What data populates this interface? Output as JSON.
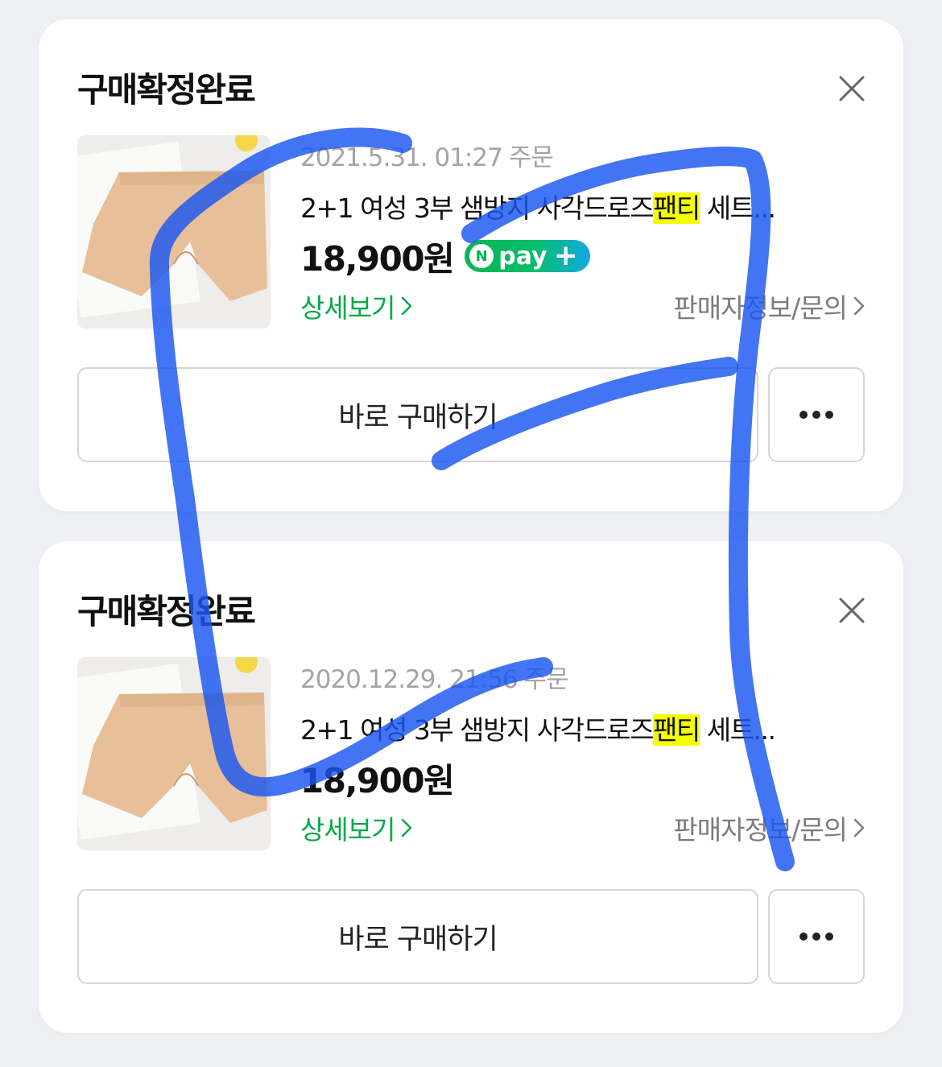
{
  "orders": [
    {
      "status": "구매확정완료",
      "order_date": "2021.5.31. 01:27",
      "order_suffix": "주문",
      "product_name_prefix": "2+1 여성 3부 샘방지 사각드로즈",
      "product_name_highlight": "팬티",
      "product_name_suffix": " 세트...",
      "price": "18,900원",
      "npay": "pay",
      "detail_label": "상세보기",
      "seller_label": "판매자정보/문의",
      "buy_label": "바로 구매하기"
    },
    {
      "status": "구매확정완료",
      "order_date": "2020.12.29. 21:56",
      "order_suffix": "주문",
      "product_name_prefix": "2+1 여성 3부 샘방지 사각드로즈",
      "product_name_highlight": "팬티",
      "product_name_suffix": " 세트...",
      "price": "18,900원",
      "npay": "",
      "detail_label": "상세보기",
      "seller_label": "판매자정보/문의",
      "buy_label": "바로 구매하기"
    }
  ],
  "colors": {
    "background": "#eef0f4",
    "card": "#ffffff",
    "link_green": "#07a94b",
    "highlight": "#f5ff00",
    "annotation_blue": "#1a56f0"
  },
  "icons": [
    "close-icon",
    "chevron-right-icon",
    "more-icon",
    "npay-plus-icon"
  ]
}
